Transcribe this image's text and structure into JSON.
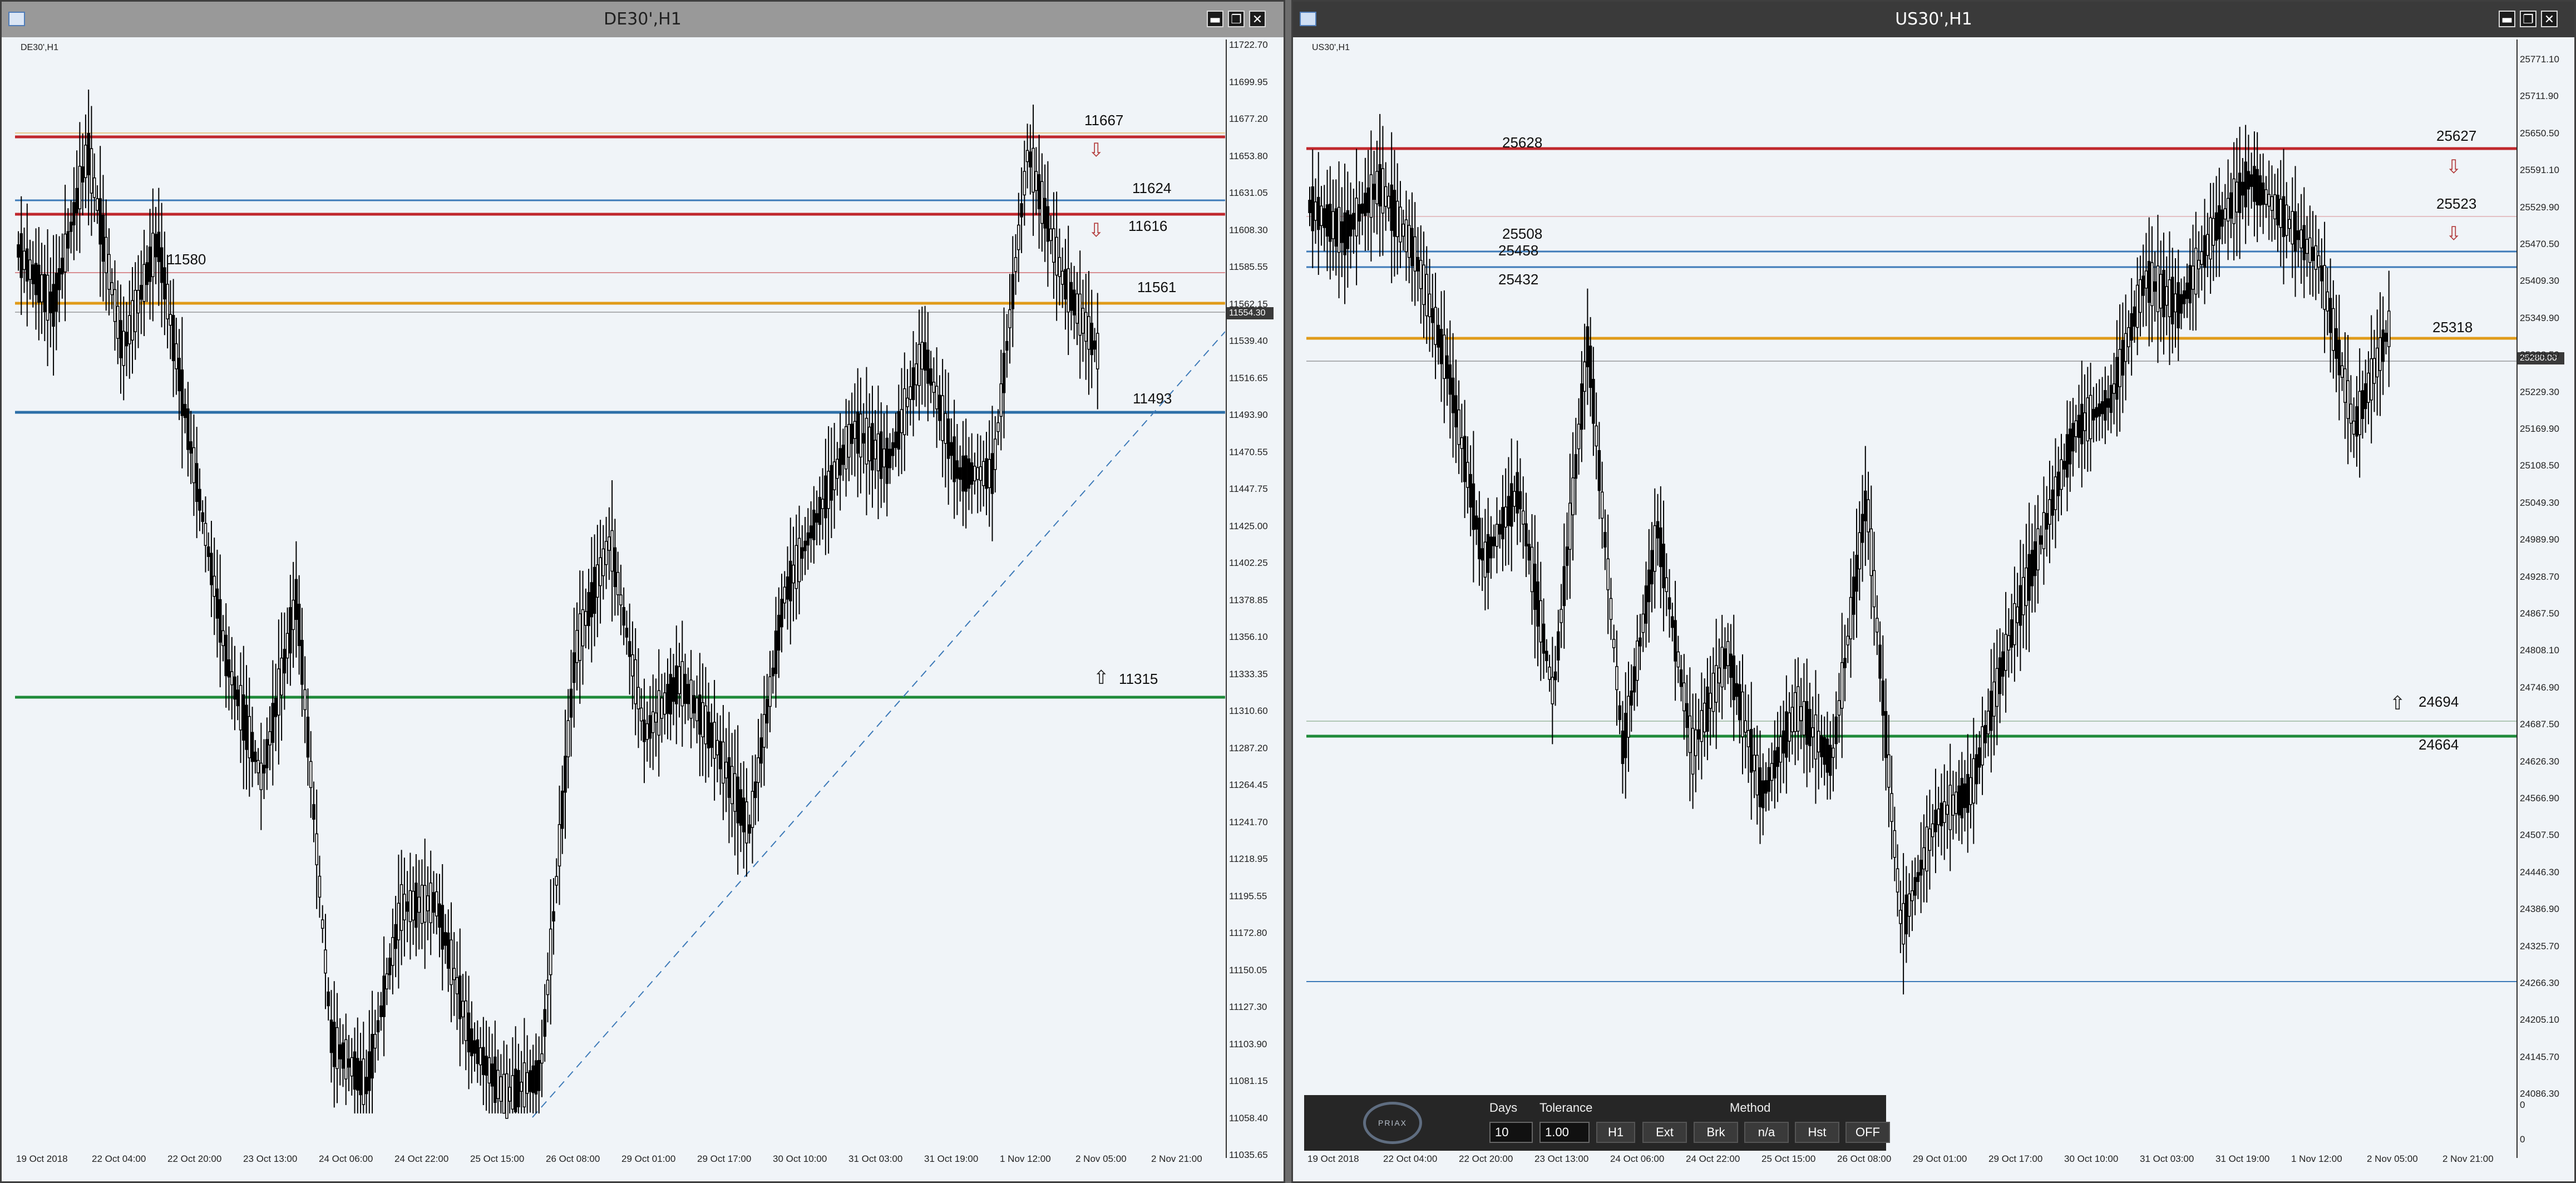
{
  "left_window": {
    "title": "DE30',H1",
    "symbol_label": "DE30',H1",
    "buttons": [
      "▬",
      "❐",
      "✕"
    ],
    "price_axis": [
      "11722.70",
      "11699.95",
      "11677.20",
      "11653.80",
      "11631.05",
      "11608.30",
      "11585.55",
      "11562.15",
      "11539.40",
      "11516.65",
      "11493.90",
      "11470.55",
      "11447.75",
      "11425.00",
      "11402.25",
      "11378.85",
      "11356.10",
      "11333.35",
      "11310.60",
      "11287.20",
      "11264.45",
      "11241.70",
      "11218.95",
      "11195.55",
      "11172.80",
      "11150.05",
      "11127.30",
      "11103.90",
      "11081.15",
      "11058.40",
      "11035.65"
    ],
    "current_price": "11554.30",
    "time_axis": [
      "19 Oct 2018",
      "22 Oct 04:00",
      "22 Oct 20:00",
      "23 Oct 13:00",
      "24 Oct 06:00",
      "24 Oct 22:00",
      "25 Oct 15:00",
      "26 Oct 08:00",
      "29 Oct 01:00",
      "29 Oct 17:00",
      "30 Oct 10:00",
      "31 Oct 03:00",
      "31 Oct 19:00",
      "1 Nov 12:00",
      "2 Nov 05:00",
      "2 Nov 21:00"
    ],
    "level_labels": [
      "11667",
      "11624",
      "11616",
      "11580",
      "11561",
      "11493",
      "11315"
    ],
    "level_colors": {
      "resistance": "#c0282d",
      "support": "#1f8a3a",
      "mid": "#e09b1a",
      "blue": "#3d7ab8"
    }
  },
  "right_window": {
    "title": "US30',H1",
    "symbol_label": "US30',H1",
    "buttons": [
      "▬",
      "❐",
      "✕"
    ],
    "price_axis": [
      "25771.10",
      "25711.90",
      "25650.50",
      "25591.10",
      "25529.90",
      "25470.50",
      "25409.30",
      "25349.90",
      "25288.50",
      "25229.30",
      "25169.90",
      "25108.50",
      "25049.30",
      "24989.90",
      "24928.70",
      "24867.50",
      "24808.10",
      "24746.90",
      "24687.50",
      "24626.30",
      "24566.90",
      "24507.50",
      "24446.30",
      "24386.90",
      "24325.70",
      "24266.30",
      "24205.10",
      "24145.70",
      "24086.30"
    ],
    "current_price": "25280.00",
    "sub_axis": [
      "0",
      "0"
    ],
    "time_axis": [
      "19 Oct 2018",
      "22 Oct 04:00",
      "22 Oct 20:00",
      "23 Oct 13:00",
      "24 Oct 06:00",
      "24 Oct 22:00",
      "25 Oct 15:00",
      "26 Oct 08:00",
      "29 Oct 01:00",
      "29 Oct 17:00",
      "30 Oct 10:00",
      "31 Oct 03:00",
      "31 Oct 19:00",
      "1 Nov 12:00",
      "2 Nov 05:00",
      "2 Nov 21:00"
    ],
    "level_labels": [
      "25628",
      "25627",
      "25523",
      "25508",
      "25458",
      "25432",
      "25318",
      "24694",
      "24664"
    ]
  },
  "panel": {
    "logo_text": "PRIAX",
    "days_label": "Days",
    "tolerance_label": "Tolerance",
    "method_label": "Method",
    "days_value": "10",
    "tolerance_value": "1.00",
    "buttons": [
      "H1",
      "Ext",
      "Brk",
      "n/a",
      "Hst",
      "OFF"
    ]
  }
}
